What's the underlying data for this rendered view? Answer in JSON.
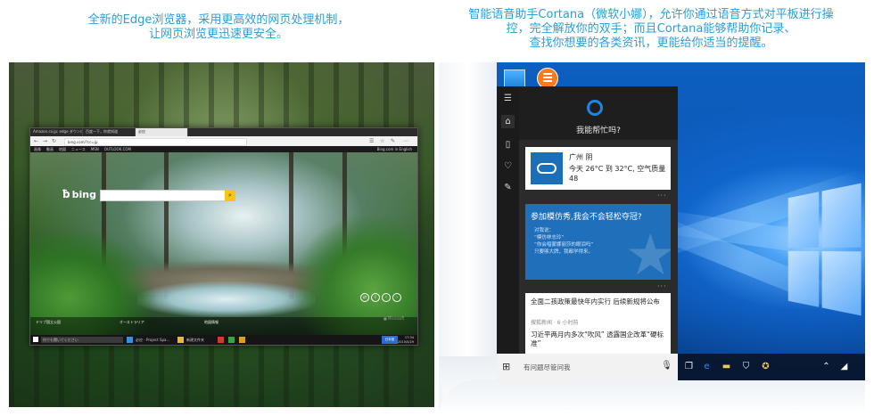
{
  "captions": {
    "left": [
      "全新的Edge浏览器，采用更高效的网页处理机制，",
      "让网页浏览更迅速更安全。"
    ],
    "right": [
      "智能语音助手Cortana（微软小娜），允许你通过语音方式对平板进行操",
      "控，完全解放你的双手；而且Cortana能够帮助你记录、",
      "查找你想要的各类资讯，更能给你适当的提醒。"
    ]
  },
  "browser": {
    "tabs": [
      "Amazon.co.jp: edge ダウンロード",
      "百度一下，你就知道",
      "必应"
    ],
    "url": "bing.com/?cc=jp",
    "menu_items": [
      "画像",
      "動画",
      "地図",
      "ニュース",
      "MSN",
      "OUTLOOK.COM"
    ],
    "menu_right": "Bing.com in English",
    "bing_logo": "bing",
    "bottom_items": [
      "ドリブ国立公園",
      "オーストラリア",
      "地図情報"
    ],
    "microsoft_label": "■ Microsoft",
    "taskbar_search": "何でも聞いてください",
    "taskbar_apps": [
      "必应 - Project Spa...",
      "新建文件夹"
    ],
    "clock": [
      "17:34",
      "2015/5/29"
    ],
    "blue_button": "日本語"
  },
  "cortana": {
    "prompt": "我能帮忙吗?",
    "weather": {
      "city": "广州 阴",
      "detail": "今天 26°C 到 32°C, 空气质量",
      "aqi": "48"
    },
    "quiz": {
      "title": "参加模仿秀,我会不会轻松夺冠?",
      "sub": [
        "对我说：",
        "“模仿林志玲”",
        "“你会唱蒙娜丽莎的眼泪吗”",
        "只要够大牌，我都学得来。"
      ]
    },
    "news": [
      {
        "title": "全面二孩政策最快年内实行 后续新规将公布",
        "source": "搜狐新闻 · 6 小时前"
      },
      {
        "title": "习近平两月内多次“吹风” 透露国企改革“硬标准”",
        "source": ""
      }
    ],
    "search_placeholder": "有问题尽管问我",
    "more": "···"
  },
  "colors": {
    "caption": "#2a9fd6",
    "cortana_accent": "#1a86e8",
    "quiz_card": "#1f6fba",
    "weather_icon": "#1a6fb8"
  }
}
